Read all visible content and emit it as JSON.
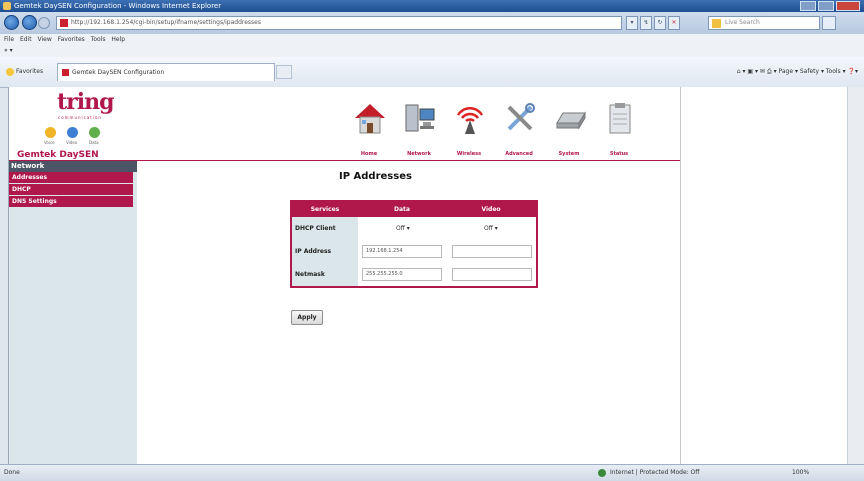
{
  "browser": {
    "title": "Gemtek DaySEN Configuration - Windows Internet Explorer",
    "address": "http://192.168.1.254/cgi-bin/setup/ifname/settings/ipaddresses",
    "live_search_placeholder": "Live Search",
    "menu": [
      "File",
      "Edit",
      "View",
      "Favorites",
      "Tools",
      "Help"
    ],
    "favorites_label": "Favorites",
    "tab_title": "Gemtek DaySEN Configuration",
    "commands": "Page ▾  Safety ▾  Tools ▾",
    "status_done": "Done",
    "status_zone": "Internet | Protected Mode: Off",
    "status_zoom": "100%"
  },
  "header": {
    "brand": "tring",
    "tagline": "communication",
    "dots": [
      {
        "label": "Voice",
        "color": "#f0b429"
      },
      {
        "label": "Video",
        "color": "#3e7fd6"
      },
      {
        "label": "Data",
        "color": "#5fb04a"
      }
    ],
    "product": "Gemtek DaySEN",
    "nav": [
      "Home",
      "Network",
      "Wireless",
      "Advanced",
      "System",
      "Status"
    ]
  },
  "sidebar": {
    "heading": "Network",
    "items": [
      "Addresses",
      "DHCP",
      "DNS Settings"
    ]
  },
  "main": {
    "title": "IP Addresses",
    "columns": [
      "Services",
      "Data",
      "Video"
    ],
    "rows": [
      {
        "label": "DHCP Client",
        "data": "Off ▾",
        "video": "Off ▾"
      },
      {
        "label": "IP Address",
        "data": "192.168.1.254",
        "video": ""
      },
      {
        "label": "Netmask",
        "data": "255.255.255.0",
        "video": ""
      }
    ],
    "apply_label": "Apply"
  },
  "colors": {
    "accent": "#b0174b",
    "sidebar_bg": "#dbe6ea",
    "sidebar_head": "#4b5565"
  }
}
